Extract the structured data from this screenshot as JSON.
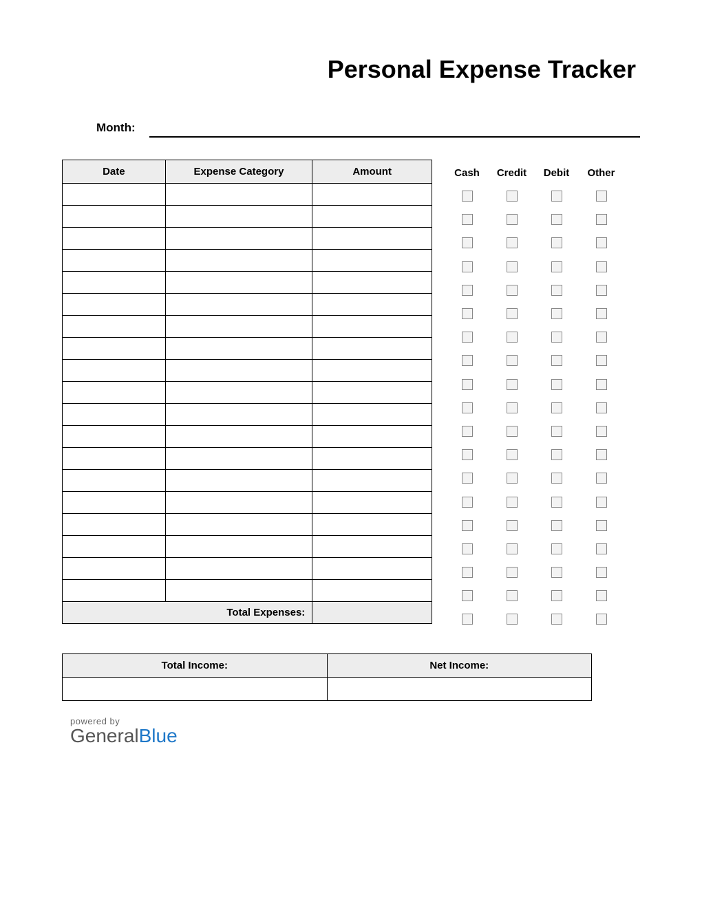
{
  "title": "Personal Expense Tracker",
  "month_label": "Month:",
  "month_value": "",
  "columns": {
    "date": "Date",
    "category": "Expense Category",
    "amount": "Amount"
  },
  "payment_headers": [
    "Cash",
    "Credit",
    "Debit",
    "Other"
  ],
  "row_count": 19,
  "rows": [
    {
      "date": "",
      "category": "",
      "amount": "",
      "cash": false,
      "credit": false,
      "debit": false,
      "other": false
    },
    {
      "date": "",
      "category": "",
      "amount": "",
      "cash": false,
      "credit": false,
      "debit": false,
      "other": false
    },
    {
      "date": "",
      "category": "",
      "amount": "",
      "cash": false,
      "credit": false,
      "debit": false,
      "other": false
    },
    {
      "date": "",
      "category": "",
      "amount": "",
      "cash": false,
      "credit": false,
      "debit": false,
      "other": false
    },
    {
      "date": "",
      "category": "",
      "amount": "",
      "cash": false,
      "credit": false,
      "debit": false,
      "other": false
    },
    {
      "date": "",
      "category": "",
      "amount": "",
      "cash": false,
      "credit": false,
      "debit": false,
      "other": false
    },
    {
      "date": "",
      "category": "",
      "amount": "",
      "cash": false,
      "credit": false,
      "debit": false,
      "other": false
    },
    {
      "date": "",
      "category": "",
      "amount": "",
      "cash": false,
      "credit": false,
      "debit": false,
      "other": false
    },
    {
      "date": "",
      "category": "",
      "amount": "",
      "cash": false,
      "credit": false,
      "debit": false,
      "other": false
    },
    {
      "date": "",
      "category": "",
      "amount": "",
      "cash": false,
      "credit": false,
      "debit": false,
      "other": false
    },
    {
      "date": "",
      "category": "",
      "amount": "",
      "cash": false,
      "credit": false,
      "debit": false,
      "other": false
    },
    {
      "date": "",
      "category": "",
      "amount": "",
      "cash": false,
      "credit": false,
      "debit": false,
      "other": false
    },
    {
      "date": "",
      "category": "",
      "amount": "",
      "cash": false,
      "credit": false,
      "debit": false,
      "other": false
    },
    {
      "date": "",
      "category": "",
      "amount": "",
      "cash": false,
      "credit": false,
      "debit": false,
      "other": false
    },
    {
      "date": "",
      "category": "",
      "amount": "",
      "cash": false,
      "credit": false,
      "debit": false,
      "other": false
    },
    {
      "date": "",
      "category": "",
      "amount": "",
      "cash": false,
      "credit": false,
      "debit": false,
      "other": false
    },
    {
      "date": "",
      "category": "",
      "amount": "",
      "cash": false,
      "credit": false,
      "debit": false,
      "other": false
    },
    {
      "date": "",
      "category": "",
      "amount": "",
      "cash": false,
      "credit": false,
      "debit": false,
      "other": false
    },
    {
      "date": "",
      "category": "",
      "amount": "",
      "cash": false,
      "credit": false,
      "debit": false,
      "other": false
    }
  ],
  "total_expenses_label": "Total Expenses:",
  "total_expenses_value": "",
  "summary": {
    "total_income_label": "Total Income:",
    "total_income_value": "",
    "net_income_label": "Net Income:",
    "net_income_value": ""
  },
  "footer": {
    "powered_by": "powered by",
    "brand_general": "General",
    "brand_blue": "Blue"
  }
}
